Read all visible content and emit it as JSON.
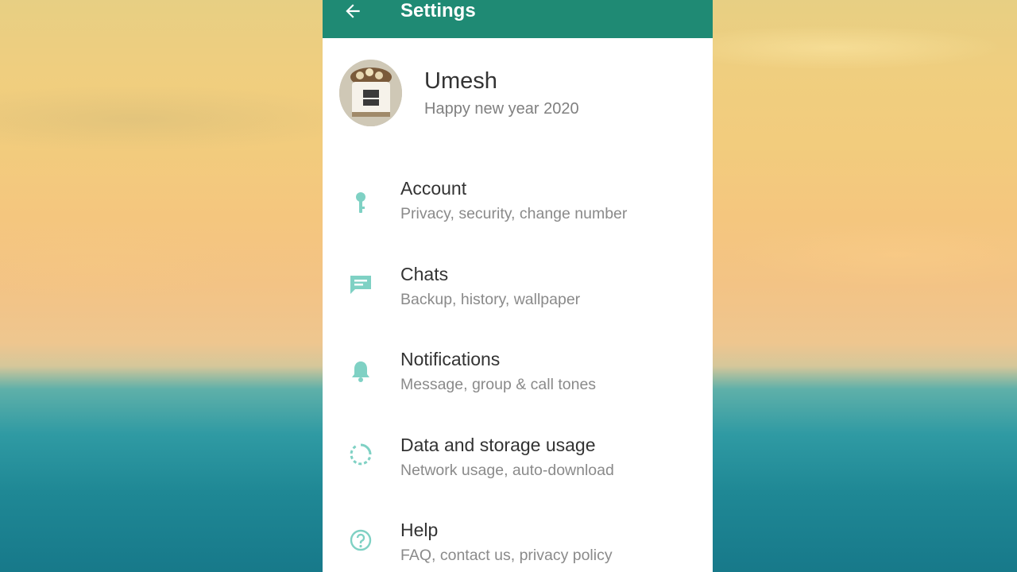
{
  "app": {
    "title": "Settings",
    "accent_color": "#1f8a74",
    "icon_color": "#7fd1c4"
  },
  "profile": {
    "name": "Umesh",
    "status": "Happy new year 2020"
  },
  "menu": [
    {
      "icon": "key-icon",
      "title": "Account",
      "subtitle": "Privacy, security, change number"
    },
    {
      "icon": "chat-icon",
      "title": "Chats",
      "subtitle": "Backup, history, wallpaper"
    },
    {
      "icon": "bell-icon",
      "title": "Notifications",
      "subtitle": "Message, group & call tones"
    },
    {
      "icon": "data-usage-icon",
      "title": "Data and storage usage",
      "subtitle": "Network usage, auto-download"
    },
    {
      "icon": "help-icon",
      "title": "Help",
      "subtitle": "FAQ, contact us, privacy policy"
    }
  ]
}
